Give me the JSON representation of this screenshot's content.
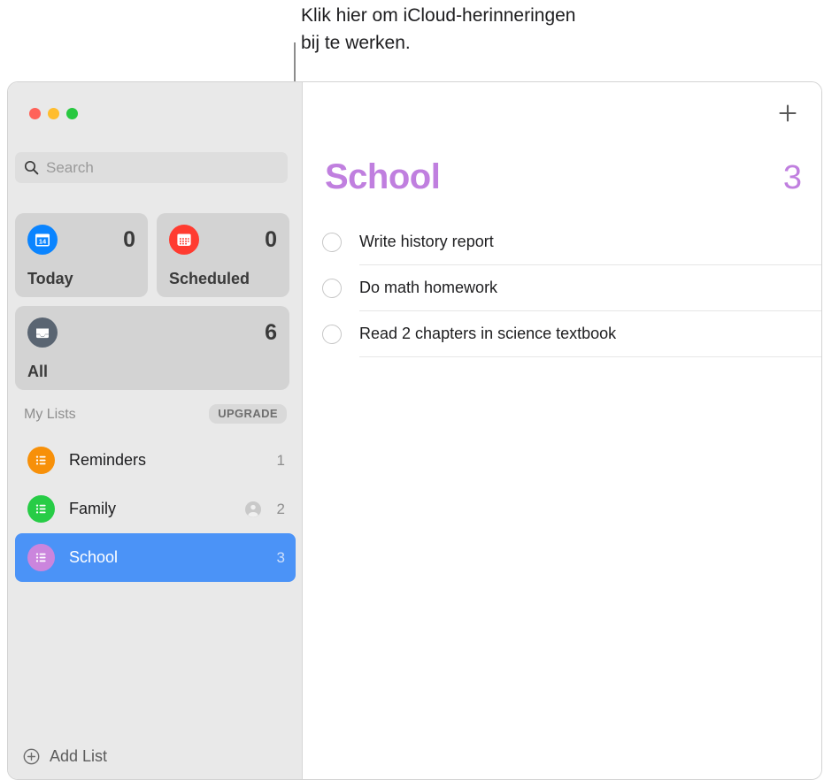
{
  "callout": {
    "text": "Klik hier om iCloud-herinneringen\nbij te werken.",
    "line_color": "#8c8c8c"
  },
  "window": {
    "traffic_lights": [
      {
        "name": "close",
        "color": "#ff6259"
      },
      {
        "name": "minimize",
        "color": "#ffbd2e"
      },
      {
        "name": "maximize",
        "color": "#28c840"
      }
    ]
  },
  "sidebar": {
    "search": {
      "placeholder": "Search",
      "value": "",
      "icon": "search-icon"
    },
    "smart_cards": [
      {
        "id": "today",
        "label": "Today",
        "count": "0",
        "icon": "calendar-day-icon",
        "icon_color": "#0a84ff",
        "icon_text": "14"
      },
      {
        "id": "scheduled",
        "label": "Scheduled",
        "count": "0",
        "icon": "calendar-grid-icon",
        "icon_color": "#ff3b30"
      },
      {
        "id": "all",
        "label": "All",
        "count": "6",
        "icon": "inbox-tray-icon",
        "icon_color": "#5a6572"
      }
    ],
    "my_lists": {
      "title": "My Lists",
      "badge": "UPGRADE"
    },
    "lists": [
      {
        "name": "Reminders",
        "count": "1",
        "icon": "bulleted-list-icon",
        "icon_color": "#f79009",
        "shared": false,
        "selected": false
      },
      {
        "name": "Family",
        "count": "2",
        "icon": "bulleted-list-icon",
        "icon_color": "#27cc46",
        "shared": true,
        "shared_icon": "person-circle-icon",
        "selected": false
      },
      {
        "name": "School",
        "count": "3",
        "icon": "bulleted-list-icon",
        "icon_color": "#cb85dd",
        "shared": false,
        "selected": true
      }
    ],
    "add_list": {
      "label": "Add List",
      "icon": "plus-circle-icon"
    }
  },
  "detail": {
    "add_button_icon": "plus-icon",
    "title": "School",
    "count": "3",
    "accent_color": "#c07fdf",
    "reminders": [
      {
        "text": "Write history report",
        "completed": false
      },
      {
        "text": "Do math homework",
        "completed": false
      },
      {
        "text": "Read 2 chapters in science textbook",
        "completed": false
      }
    ]
  }
}
